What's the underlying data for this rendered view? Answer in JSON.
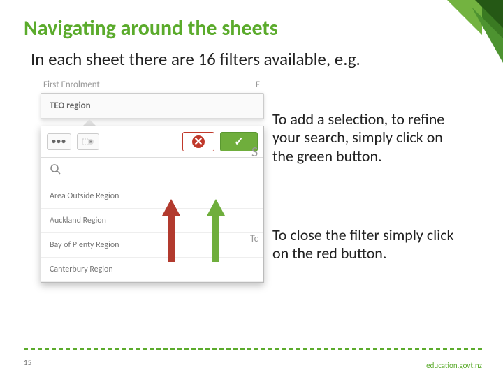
{
  "slide": {
    "title": "Navigating around the sheets",
    "subtitle": "In each sheet there are 16 filters available, e.g."
  },
  "info": {
    "add": "To add a selection, to refine your search, simply click on the green button.",
    "close": "To close the filter simply click on the red button."
  },
  "filter": {
    "header_left": "First Enrolment",
    "header_right": "F",
    "label": "TEO region",
    "dots": "•••",
    "search_placeholder": "",
    "s_label": "S",
    "tc_label": "Tc",
    "items": [
      "Area Outside Region",
      "Auckland Region",
      "Bay of Plenty Region",
      "Canterbury Region"
    ]
  },
  "footer": {
    "page": "15",
    "domain": "education.govt.nz"
  }
}
